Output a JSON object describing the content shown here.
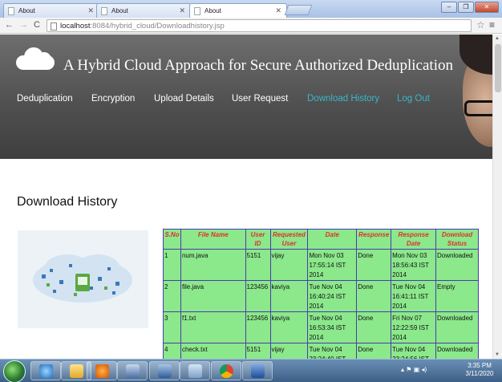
{
  "browser": {
    "tabs": [
      {
        "label": "About"
      },
      {
        "label": "About"
      },
      {
        "label": "About"
      }
    ],
    "address": {
      "host": "localhost",
      "path": ":8084/hybrid_cloud/Downloadhistory.jsp"
    }
  },
  "site": {
    "title": "A Hybrid Cloud Approach for Secure Authorized Deduplication",
    "nav": [
      "Deduplication",
      "Encryption",
      "Upload Details",
      "User Request",
      "Download History",
      "Log Out"
    ]
  },
  "page": {
    "heading": "Download History"
  },
  "table": {
    "headers": [
      "S.No",
      "File Name",
      "User ID",
      "Requested User",
      "Date",
      "Response",
      "Response Date",
      "Download Status"
    ],
    "rows": [
      [
        "1",
        "num.java",
        "5151",
        "vijay",
        "Mon Nov 03 17:55:14 IST 2014",
        "Done",
        "Mon Nov 03 18:56:43 IST 2014",
        "Downloaded"
      ],
      [
        "2",
        "file.java",
        "123456",
        "kaviya",
        "Tue Nov 04 16:40:24 IST 2014",
        "Done",
        "Tue Nov 04 16:41:11 IST 2014",
        "Empty"
      ],
      [
        "3",
        "f1.txt",
        "123456",
        "kaviya",
        "Tue Nov 04 16:53:34 IST 2014",
        "Done",
        "Fri Nov 07 12:22:59 IST 2014",
        "Downloaded"
      ],
      [
        "4",
        "check.txt",
        "5151",
        "vijay",
        "Tue Nov 04 23:24:40 IST",
        "Done",
        "Tue Nov 04 23:24:56 IST",
        "Downloaded"
      ]
    ]
  },
  "taskbar": {
    "time": "3:35 PM",
    "date": "3/11/2020"
  },
  "colors": {
    "header_bg": "#555555",
    "nav_active": "#39b6c9",
    "table_bg": "#8be88b",
    "table_header_text": "#e03030",
    "table_border": "#4a3cb0"
  }
}
